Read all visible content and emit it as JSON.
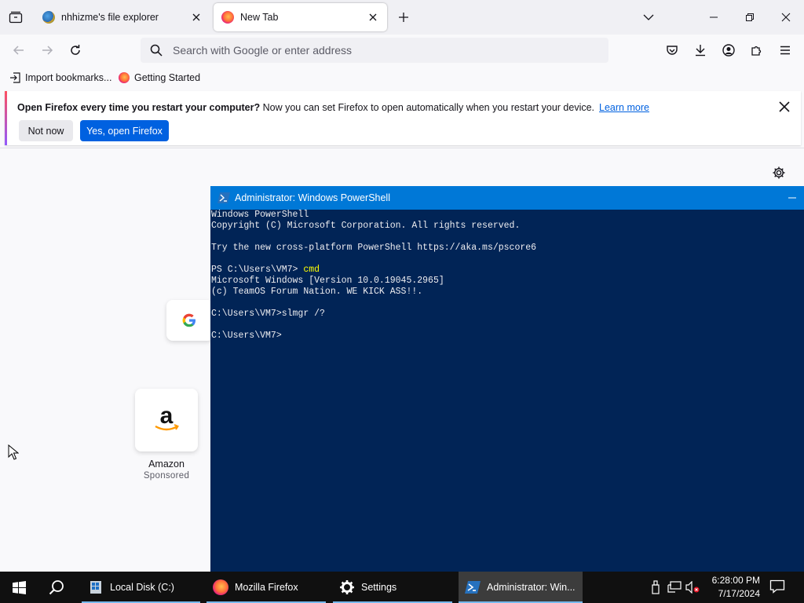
{
  "browser": {
    "tabs": [
      {
        "title": "nhhizme's file explorer",
        "active": false
      },
      {
        "title": "New Tab",
        "active": true
      }
    ],
    "urlbar": {
      "placeholder": "Search with Google or enter address"
    },
    "bookmarks": [
      {
        "label": "Import bookmarks..."
      },
      {
        "label": "Getting Started"
      }
    ],
    "notification": {
      "bold": "Open Firefox every time you restart your computer?",
      "text": " Now you can set Firefox to open automatically when you restart your device.",
      "link": "Learn more",
      "not_now": "Not now",
      "yes": "Yes, open Firefox"
    },
    "newtab": {
      "shortcuts": [
        {
          "name": "Google",
          "icon": "google-icon"
        },
        {
          "name": "Amazon",
          "sub": "Sponsored",
          "icon": "amazon-icon"
        }
      ]
    }
  },
  "powershell": {
    "title": "Administrator: Windows PowerShell",
    "lines": [
      "Windows PowerShell",
      "Copyright (C) Microsoft Corporation. All rights reserved.",
      "",
      "Try the new cross-platform PowerShell https://aka.ms/pscore6",
      "",
      "PS C:\\Users\\VM7> ",
      "Microsoft Windows [Version 10.0.19045.2965]",
      "(c) TeamOS Forum Nation. WE KICK ASS!!.",
      "",
      "C:\\Users\\VM7>slmgr /?",
      "",
      "C:\\Users\\VM7>"
    ],
    "command": "cmd"
  },
  "taskbar": {
    "apps": [
      {
        "label": "Local Disk (C:)",
        "icon": "folder-icon"
      },
      {
        "label": "Mozilla Firefox",
        "icon": "firefox-icon"
      },
      {
        "label": "Settings",
        "icon": "gear-icon"
      },
      {
        "label": "Administrator: Win...",
        "icon": "powershell-icon",
        "active": true
      }
    ],
    "time": "6:28:00 PM",
    "date": "7/17/2024"
  },
  "colors": {
    "ps_bg": "#012456",
    "accent": "#0061e0",
    "titlebar": "#0078d7"
  }
}
